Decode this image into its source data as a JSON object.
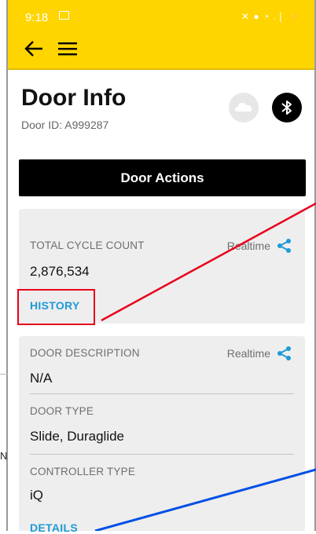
{
  "status_bar": {
    "time": "9:18",
    "icons": "✕ ● ◔ .❘ ⚡"
  },
  "app_bar": {
    "back_icon": "arrow-left-icon",
    "menu_icon": "hamburger-menu-icon"
  },
  "header": {
    "title": "Door Info",
    "subtitle": "Door ID: A999287"
  },
  "toolbar": {
    "cloud_icon": "cloud-icon",
    "bluetooth_icon": "bluetooth-icon",
    "actions_label": "Door Actions"
  },
  "cycle_card": {
    "label": "TOTAL CYCLE COUNT",
    "realtime": "Realtime",
    "value": "2,876,534",
    "link": "HISTORY"
  },
  "description_card": {
    "realtime": "Realtime",
    "description_label": "DOOR DESCRIPTION",
    "description_value": "N/A",
    "type_label": "DOOR TYPE",
    "type_value": "Slide, Duraglide",
    "controller_label": "CONTROLLER TYPE",
    "controller_value": "iQ",
    "link": "DETAILS"
  },
  "stray_text": "N",
  "colors": {
    "brand_yellow": "#ffd500",
    "link_blue": "#1f9ad6",
    "annotation_red": "#e8001c",
    "annotation_blue": "#0050e6"
  }
}
